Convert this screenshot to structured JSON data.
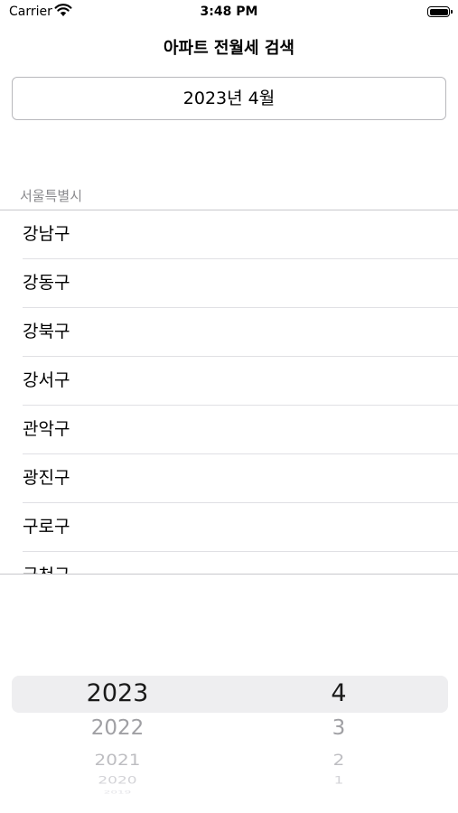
{
  "status_bar": {
    "carrier": "Carrier",
    "time": "3:48 PM"
  },
  "nav": {
    "title": "아파트 전월세 검색"
  },
  "date_button": {
    "label": "2023년 4월"
  },
  "section": {
    "header": "서울특별시",
    "items": [
      {
        "label": "강남구"
      },
      {
        "label": "강동구"
      },
      {
        "label": "강북구"
      },
      {
        "label": "강서구"
      },
      {
        "label": "관악구"
      },
      {
        "label": "광진구"
      },
      {
        "label": "구로구"
      },
      {
        "label": "금천구"
      }
    ]
  },
  "picker": {
    "year": {
      "selected": "2023",
      "below": [
        "2022",
        "2021",
        "2020",
        "2019"
      ]
    },
    "month": {
      "selected": "4",
      "below": [
        "3",
        "2",
        "1"
      ]
    }
  },
  "colors": {
    "separator": "#c8c8cc",
    "secondary_text": "#8a8a8e",
    "picker_highlight": "#eeeef0"
  }
}
